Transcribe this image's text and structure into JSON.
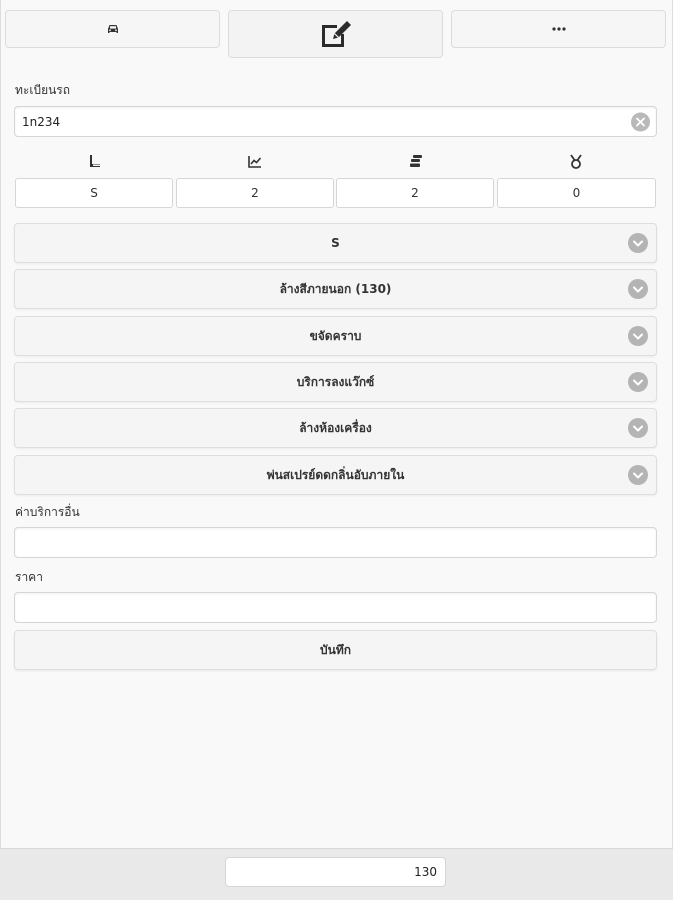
{
  "tabs": [
    {
      "icon": "car-icon"
    },
    {
      "icon": "edit-icon"
    },
    {
      "icon": "more-icon"
    }
  ],
  "plate": {
    "label": "ทะเบียนรถ",
    "value": "1n234"
  },
  "stats": [
    {
      "icon": "seat-icon",
      "value": "S"
    },
    {
      "icon": "chart-icon",
      "value": "2"
    },
    {
      "icon": "coins-icon",
      "value": "2"
    },
    {
      "icon": "medal-icon",
      "value": "0"
    }
  ],
  "services": [
    {
      "title": "S"
    },
    {
      "title": "ล้างสีภายนอก (130)"
    },
    {
      "title": "ขจัดคราบ"
    },
    {
      "title": "บริการลงแว๊กซ์"
    },
    {
      "title": "ล้างห้องเครื่อง"
    },
    {
      "title": "พ่นสเปรย์ดดกลิ่นอับภายใน"
    }
  ],
  "other_service": {
    "label": "ค่าบริการอื่น",
    "value": ""
  },
  "price": {
    "label": "ราคา",
    "value": ""
  },
  "save_label": "บันทึก",
  "total": "130"
}
